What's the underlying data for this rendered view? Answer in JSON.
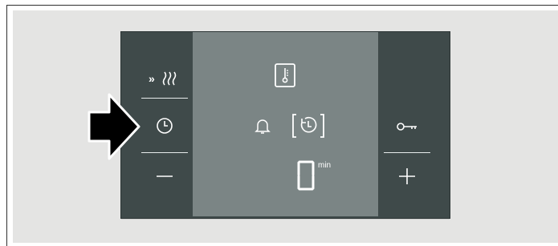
{
  "left_keys": {
    "rapid_heat": {
      "label": "»≀",
      "icon": "rapid-heat-icon"
    },
    "clock": {
      "icon": "clock-icon"
    },
    "minus": {
      "icon": "minus-icon"
    }
  },
  "right_keys": {
    "child_lock": {
      "icon": "key-icon"
    },
    "plus": {
      "icon": "plus-icon"
    }
  },
  "display": {
    "thermometer_icon": "thermometer-icon",
    "bell_icon": "bell-icon",
    "timer_icon": "timer-icon",
    "value": "0",
    "unit": "min"
  },
  "pointer": {
    "icon": "arrow-right-icon"
  },
  "colors": {
    "panel": "#3f4a4a",
    "display": "#7b8585",
    "background": "#e4e4e3",
    "arrow": "#000000"
  }
}
